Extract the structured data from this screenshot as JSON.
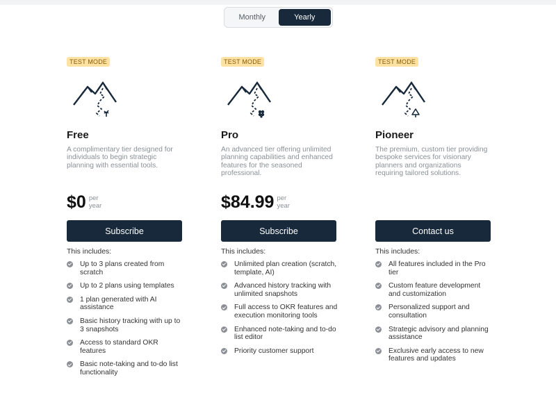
{
  "billing_toggle": {
    "monthly_label": "Monthly",
    "yearly_label": "Yearly",
    "selected": "Yearly"
  },
  "plans": [
    {
      "badge": "TEST MODE",
      "name": "Free",
      "description": "A complimentary tier designed for individuals to begin strategic planning with essential tools.",
      "price": "$0",
      "per_line1": "per",
      "per_line2": "year",
      "button_label": "Subscribe",
      "includes_label": "This includes:",
      "icon": "mountain-sprout-icon",
      "features": [
        "Up to 3 plans created from scratch",
        "Up to 2 plans using templates",
        "1 plan generated with AI assistance",
        "Basic history tracking with up to 3 snapshots",
        "Access to standard OKR features",
        "Basic note-taking and to-do list functionality"
      ]
    },
    {
      "badge": "TEST MODE",
      "name": "Pro",
      "description": "An advanced tier offering unlimited planning capabilities and enhanced features for the seasoned professional.",
      "price": "$84.99",
      "per_line1": "per",
      "per_line2": "year",
      "button_label": "Subscribe",
      "includes_label": "This includes:",
      "icon": "mountain-bush-icon",
      "features": [
        "Unlimited plan creation (scratch, template, AI)",
        "Advanced history tracking with unlimited snapshots",
        "Full access to OKR features and execution monitoring tools",
        "Enhanced note-taking and to-do list editor",
        "Priority customer support"
      ]
    },
    {
      "badge": "TEST MODE",
      "name": "Pioneer",
      "description": "The premium, custom tier providing bespoke services for visionary planners and organizations requiring tailored solutions.",
      "button_label": "Contact us",
      "includes_label": "This includes:",
      "icon": "mountain-tree-icon",
      "features": [
        "All features included in the Pro tier",
        "Custom feature development and customization",
        "Personalized support and consultation",
        "Strategic advisory and planning assistance",
        "Exclusive early access to new features and updates"
      ]
    }
  ],
  "colors": {
    "primary": "#17293a",
    "badge_bg": "#fde2a4",
    "badge_text": "#8a5a00",
    "muted_text": "#8b9096"
  }
}
